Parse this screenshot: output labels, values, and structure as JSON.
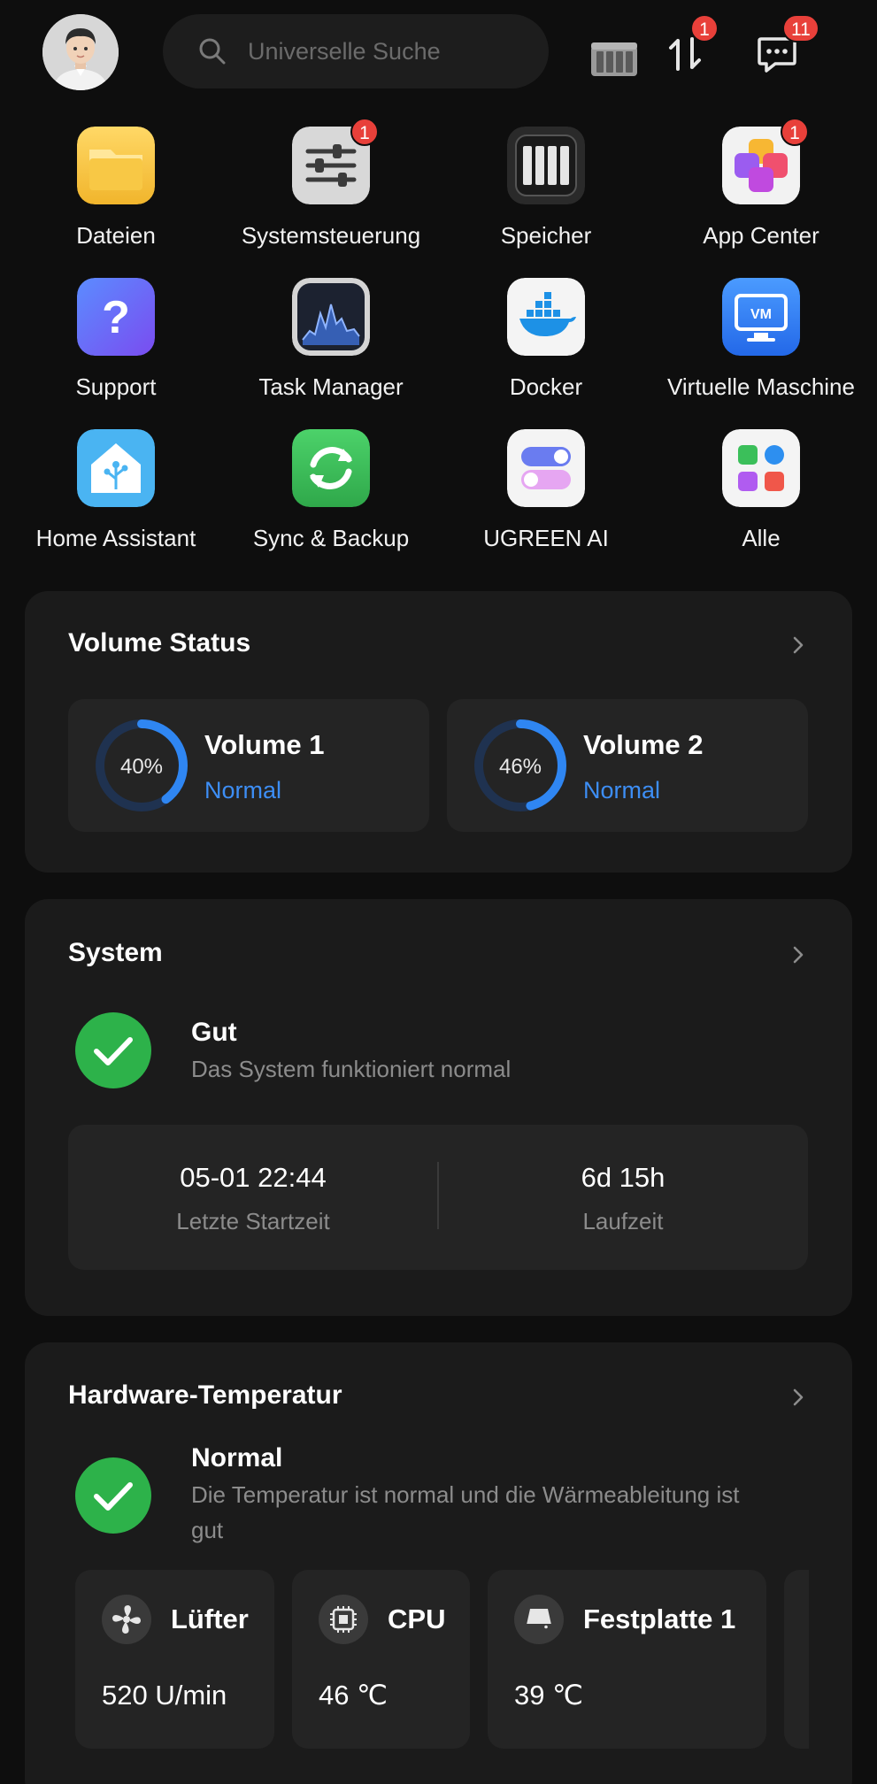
{
  "header": {
    "search_placeholder": "Universelle Suche",
    "transfer_badge": "1",
    "messages_badge": "11"
  },
  "apps": [
    {
      "label": "Dateien",
      "icon": "folder-icon",
      "badge": ""
    },
    {
      "label": "Systemsteuerung",
      "icon": "sliders-icon",
      "badge": "1"
    },
    {
      "label": "Speicher",
      "icon": "storage-icon",
      "badge": ""
    },
    {
      "label": "App Center",
      "icon": "app-center-icon",
      "badge": "1"
    },
    {
      "label": "Support",
      "icon": "question-icon",
      "badge": ""
    },
    {
      "label": "Task Manager",
      "icon": "activity-chart-icon",
      "badge": ""
    },
    {
      "label": "Docker",
      "icon": "docker-whale-icon",
      "badge": ""
    },
    {
      "label": "Virtuelle Maschine",
      "icon": "vm-monitor-icon",
      "badge": ""
    },
    {
      "label": "Home Assistant",
      "icon": "home-assistant-icon",
      "badge": ""
    },
    {
      "label": "Sync & Backup",
      "icon": "sync-icon",
      "badge": ""
    },
    {
      "label": "UGREEN AI",
      "icon": "toggles-icon",
      "badge": ""
    },
    {
      "label": "Alle",
      "icon": "all-apps-icon",
      "badge": ""
    }
  ],
  "volume_status": {
    "title": "Volume Status",
    "volumes": [
      {
        "name": "Volume 1",
        "percent": 40,
        "percent_label": "40%",
        "state": "Normal"
      },
      {
        "name": "Volume 2",
        "percent": 46,
        "percent_label": "46%",
        "state": "Normal"
      }
    ]
  },
  "system": {
    "title": "System",
    "status": "Gut",
    "description": "Das System funktioniert normal",
    "last_start_value": "05-01 22:44",
    "last_start_label": "Letzte Startzeit",
    "uptime_value": "6d 15h",
    "uptime_label": "Laufzeit"
  },
  "hardware": {
    "title": "Hardware-Temperatur",
    "status": "Normal",
    "description_line1": "Die Temperatur ist normal und die Wärmeableitung ist",
    "description_line2": "gut",
    "items": [
      {
        "name": "Lüfter",
        "value": "520 U/min",
        "icon": "fan-icon"
      },
      {
        "name": "CPU",
        "value": "46 ℃",
        "icon": "cpu-chip-icon"
      },
      {
        "name": "Festplatte 1",
        "value": "39 ℃",
        "icon": "hard-disk-icon"
      }
    ]
  },
  "colors": {
    "background": "#0e0e0e",
    "card": "#1b1b1b",
    "accent_blue": "#3d8ef5",
    "success_green": "#2db24a",
    "badge_red": "#e8403a"
  }
}
